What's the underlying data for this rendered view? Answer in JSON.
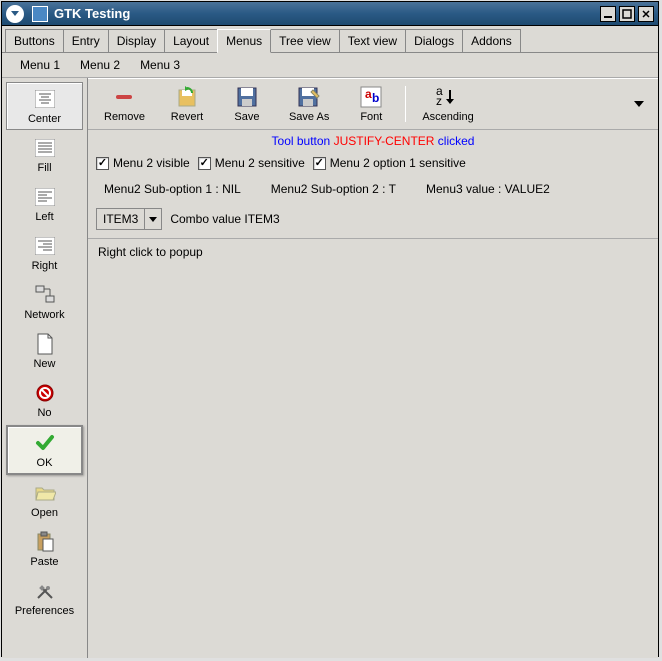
{
  "window": {
    "title": "GTK Testing"
  },
  "tabs": [
    "Buttons",
    "Entry",
    "Display",
    "Layout",
    "Menus",
    "Tree view",
    "Text view",
    "Dialogs",
    "Addons"
  ],
  "active_tab": "Menus",
  "menubar": [
    "Menu 1",
    "Menu 2",
    "Menu 3"
  ],
  "sidebar": [
    {
      "label": "Center"
    },
    {
      "label": "Fill"
    },
    {
      "label": "Left"
    },
    {
      "label": "Right"
    },
    {
      "label": "Network"
    },
    {
      "label": "New"
    },
    {
      "label": "No"
    },
    {
      "label": "OK"
    },
    {
      "label": "Open"
    },
    {
      "label": "Paste"
    },
    {
      "label": "Preferences"
    }
  ],
  "toolbar": {
    "remove": "Remove",
    "revert": "Revert",
    "save": "Save",
    "save_as": "Save As",
    "font": "Font",
    "ascending": "Ascending"
  },
  "status": {
    "prefix": "Tool button ",
    "action": "JUSTIFY-CENTER",
    "suffix": " clicked"
  },
  "checks": {
    "c1": "Menu 2 visible",
    "c2": "Menu 2 sensitive",
    "c3": "Menu 2 option 1 sensitive"
  },
  "info": {
    "sub1": "Menu2 Sub-option 1 : NIL",
    "sub2": "Menu2 Sub-option 2 : T",
    "menu3": "Menu3 value : VALUE2"
  },
  "combo": {
    "value": "ITEM3",
    "label": "Combo value ITEM3"
  },
  "popup": "Right click to popup"
}
